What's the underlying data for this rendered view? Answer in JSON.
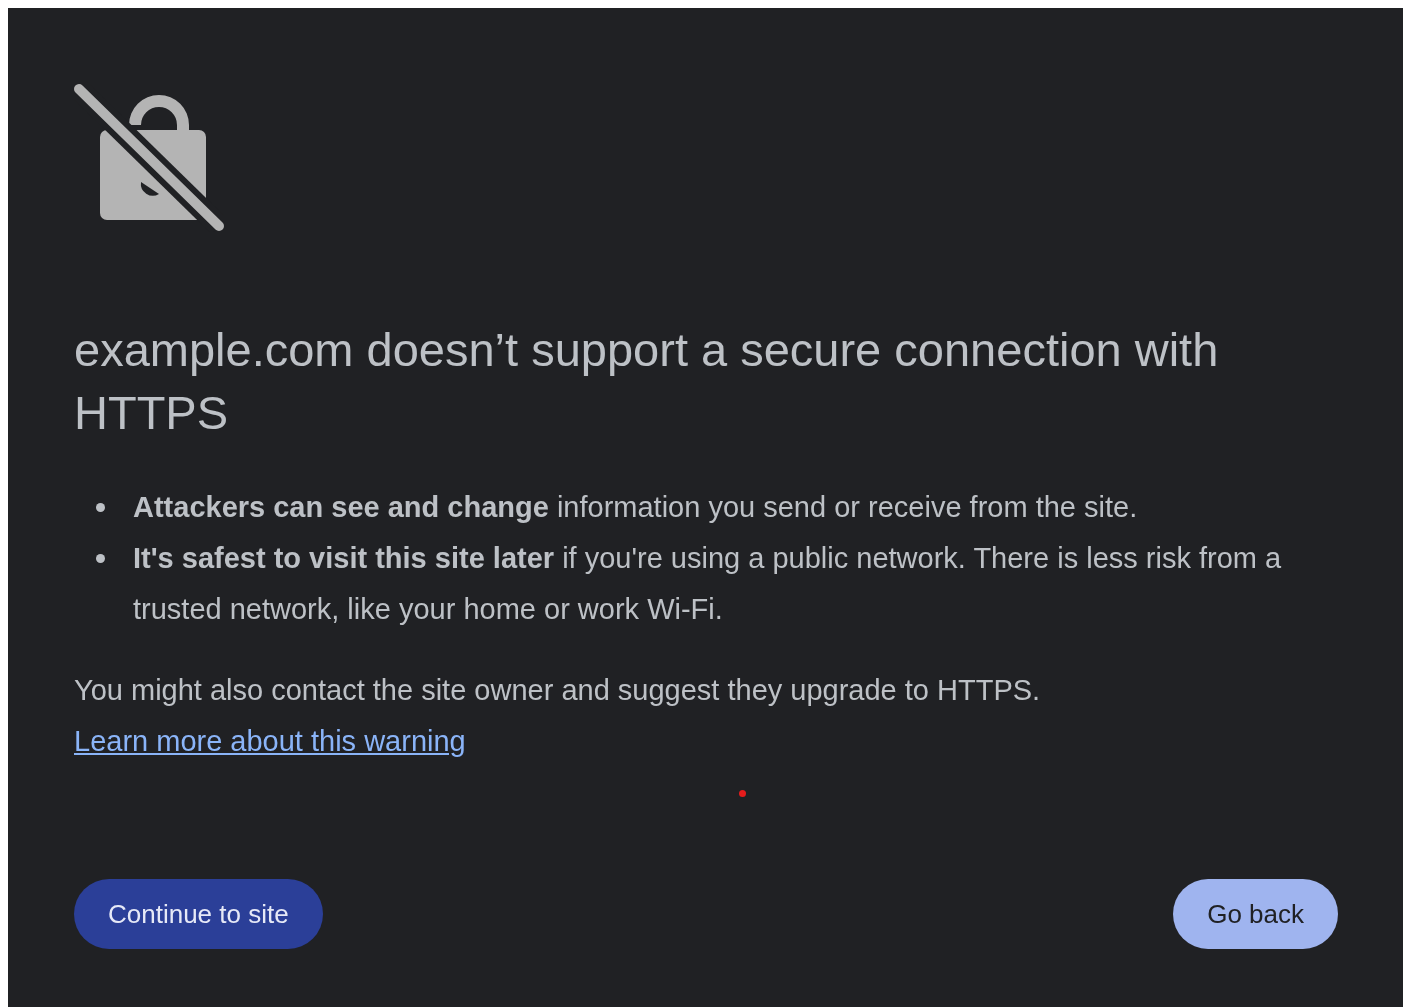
{
  "title": "example.com doesn’t support a secure connection with HTTPS",
  "bullets": [
    "**Attackers can see and change** information you send or receive from the site.",
    "**It's safest to visit this site later** if you're using a public network. There is less risk from a trusted network, like your home or work Wi-Fi."
  ],
  "note": {
    "text": "You might also contact the site owner and suggest they upgrade to HTTPS.",
    "link": "Learn more about this warning"
  },
  "buttons": [
    {
      "label": "Continue to site",
      "kind": "secondary"
    },
    {
      "label": "Go back",
      "kind": "primary"
    }
  ]
}
